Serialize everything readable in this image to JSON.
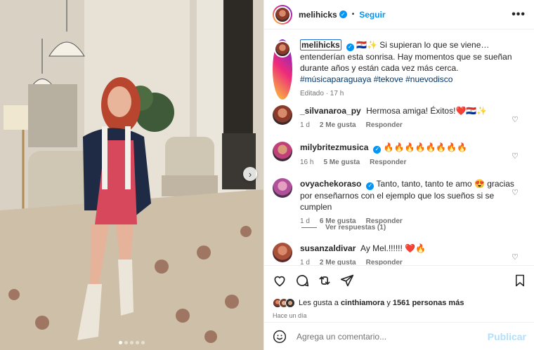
{
  "post": {
    "username": "melihicks",
    "follow_label": "Seguir",
    "more_glyph": "•••",
    "dot": "•"
  },
  "caption": {
    "username": "melihicks",
    "flag": "🇵🇾",
    "sparkle": "✨",
    "text": "Si supieran lo que se viene… entenderían esta sonrisa. Hay momentos que se sueñan durante años y están cada vez más cerca.",
    "hashtags": "#músicaparaguaya #tekove #nuevodisco",
    "edited": "Editado · 17 h"
  },
  "comments": [
    {
      "username": "_silvanaroa_py",
      "verified": false,
      "text": "Hermosa amiga! Éxitos!❤️🇵🇾✨",
      "time": "1 d",
      "likes": "2 Me gusta",
      "reply": "Responder"
    },
    {
      "username": "milybritezmusica",
      "verified": true,
      "text": "🔥🔥🔥🔥🔥🔥🔥🔥",
      "time": "16 h",
      "likes": "5 Me gusta",
      "reply": "Responder"
    },
    {
      "username": "ovyachekoraso",
      "verified": true,
      "text": "Tanto, tanto, tanto te amo 😍 gracias por enseñarnos con el ejemplo que los sueños si se cumplen",
      "time": "1 d",
      "likes": "6 Me gusta",
      "reply": "Responder"
    },
    {
      "username": "susanzaldivar",
      "verified": false,
      "text": "Ay Mel.!!!!!! ❤️🔥",
      "time": "1 d",
      "likes": "2 Me gusta",
      "reply": "Responder"
    }
  ],
  "view_replies": "Ver respuestas (1)",
  "likes": {
    "prefix": "Les gusta a ",
    "user": "cinthiamora",
    "middle": " y ",
    "count": "1561 personas más"
  },
  "time_ago": "Hace un día",
  "composer": {
    "placeholder": "Agrega un comentario...",
    "post_label": "Publicar"
  },
  "carousel": {
    "next_glyph": "›",
    "slides": 5,
    "active": 0
  },
  "colors": {
    "accent": "#0095f6",
    "link": "#00376b",
    "muted": "#737373",
    "post_disabled": "#b2dffc"
  },
  "icons": [
    "heart-icon",
    "comment-icon",
    "share-icon",
    "send-icon",
    "bookmark-icon",
    "emoji-icon",
    "more-icon",
    "verified-icon"
  ]
}
